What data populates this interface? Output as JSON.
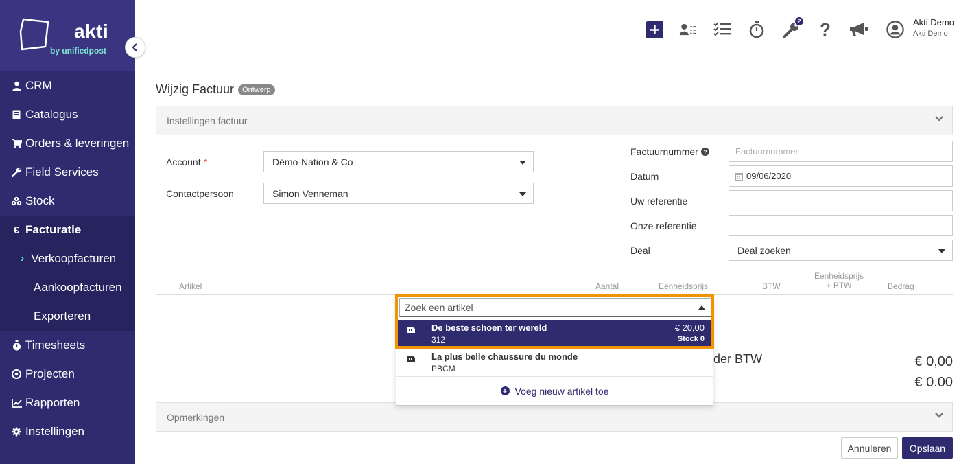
{
  "brand": {
    "name": "akti",
    "subtitle": "by unifiedpost",
    "accent": "#2f2b6f",
    "highlight": "#7fe3d4"
  },
  "sidebar": {
    "items": [
      {
        "label": "CRM",
        "icon": "user-icon"
      },
      {
        "label": "Catalogus",
        "icon": "book-icon"
      },
      {
        "label": "Orders & leveringen",
        "icon": "cart-icon"
      },
      {
        "label": "Field Services",
        "icon": "wrench-icon"
      },
      {
        "label": "Stock",
        "icon": "cubes-icon"
      },
      {
        "label": "Facturatie",
        "icon": "euro-icon"
      }
    ],
    "sub_items": [
      {
        "label": "Verkoopfacturen"
      },
      {
        "label": "Aankoopfacturen"
      },
      {
        "label": "Exporteren"
      }
    ],
    "bottom_items": [
      {
        "label": "Timesheets",
        "icon": "stopwatch-icon"
      },
      {
        "label": "Projecten",
        "icon": "target-icon"
      },
      {
        "label": "Rapporten",
        "icon": "chart-icon"
      },
      {
        "label": "Instellingen",
        "icon": "gear-icon"
      }
    ]
  },
  "topbar": {
    "notifications_count": "2",
    "user_name": "Akti Demo",
    "user_company": "Akti Demo"
  },
  "page": {
    "title": "Wijzig Factuur",
    "status": "Ontwerp"
  },
  "settings_panel": {
    "title": "Instellingen factuur"
  },
  "form": {
    "account_label": "Account",
    "account_value": "Démo-Nation & Co",
    "contact_label": "Contactpersoon",
    "contact_value": "Simon Venneman",
    "invoice_number_label": "Factuurnummer",
    "invoice_number_placeholder": "Factuurnummer",
    "date_label": "Datum",
    "date_value": "09/06/2020",
    "your_ref_label": "Uw referentie",
    "our_ref_label": "Onze referentie",
    "deal_label": "Deal",
    "deal_value": "Deal zoeken"
  },
  "table": {
    "headers": {
      "article": "Artikel",
      "quantity": "Aantal",
      "unit_price": "Eenheidsprijs",
      "vat": "BTW",
      "unit_price_vat_1": "Eenheidsprijs",
      "unit_price_vat_2": "+ BTW",
      "amount": "Bedrag"
    }
  },
  "totals": {
    "label": "der BTW",
    "value_1": "€ 0,00",
    "value_2": "€ 0.00"
  },
  "dropdown": {
    "search_placeholder": "Zoek een artikel",
    "items": [
      {
        "name": "De beste schoen ter wereld",
        "code": "312",
        "price": "€ 20,00",
        "stock": "Stock 0"
      },
      {
        "name": "La plus belle chaussure du monde",
        "code": "PBCM"
      }
    ],
    "add_label": "Voeg nieuw artikel toe"
  },
  "remarks_panel": {
    "title": "Opmerkingen"
  },
  "actions": {
    "cancel": "Annuleren",
    "save": "Opslaan"
  }
}
